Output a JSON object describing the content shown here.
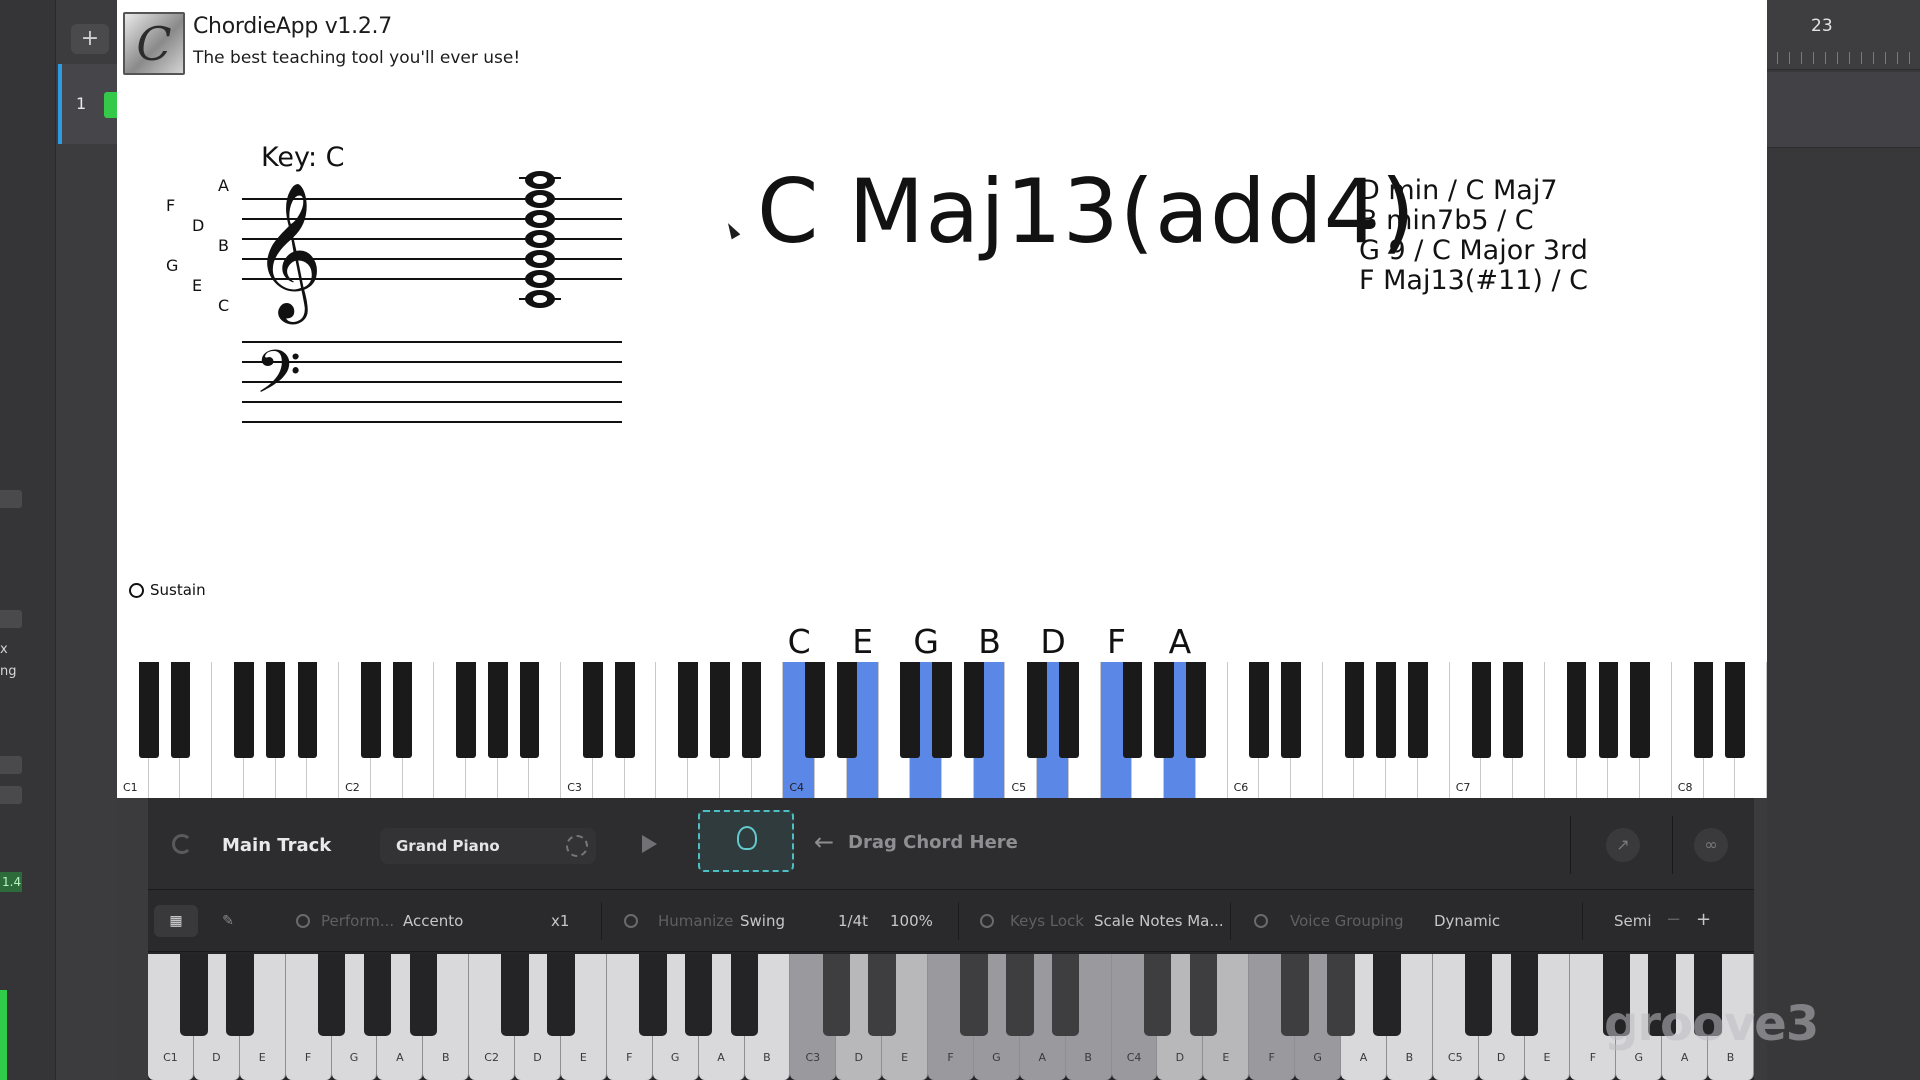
{
  "host": {
    "add_label": "+",
    "track_number": "1",
    "ruler_number": "23",
    "side_text_1": "x",
    "side_text_2": "ng",
    "side_value": "1.4"
  },
  "app": {
    "title": "ChordieApp v1.2.7",
    "subtitle": "The best teaching tool you'll ever use!",
    "logo_glyph": "C"
  },
  "staff": {
    "key_label": "Key: C",
    "left_letters": [
      "F",
      "G"
    ],
    "mid_letters": [
      "D",
      "E"
    ],
    "right_letters": [
      "A",
      "B",
      "C"
    ]
  },
  "chord": {
    "name": "C Maj13(add4)",
    "alternatives": [
      "D min / C Maj7",
      "B min7b5 / C",
      "G 9 / C Major 3rd",
      "F Maj13(#11) / C"
    ]
  },
  "sustain_label": "Sustain",
  "chord_notes": [
    "C",
    "E",
    "G",
    "B",
    "D",
    "F",
    "A"
  ],
  "top_keyboard": {
    "octave_labels": [
      "C1",
      "C2",
      "C3",
      "C4",
      "C5",
      "C6",
      "C7",
      "C8"
    ]
  },
  "panel": {
    "track_name": "Main Track",
    "instrument": "Grand Piano",
    "drag_hint": "Drag Chord Here",
    "arrow": "←",
    "bar": {
      "perform": "Perform...",
      "accent": "Accento",
      "multiplier": "x1",
      "humanize": "Humanize",
      "swing": "Swing",
      "division": "1/4t",
      "percent": "100%",
      "keys_lock": "Keys Lock",
      "scale_mode": "Scale Notes Ma...",
      "voice_grouping": "Voice Grouping",
      "dynamic": "Dynamic",
      "semi": "Semi",
      "minus": "−",
      "plus": "+"
    },
    "key_labels": [
      "C1",
      "D",
      "E",
      "F",
      "G",
      "A",
      "B",
      "C2",
      "D",
      "E",
      "F",
      "G",
      "A",
      "B",
      "C3",
      "D",
      "E",
      "F",
      "G",
      "A",
      "B",
      "C4",
      "D",
      "E",
      "F",
      "G",
      "A",
      "B",
      "C5",
      "D",
      "E",
      "F",
      "G",
      "A",
      "B"
    ]
  },
  "watermark": "groove3"
}
